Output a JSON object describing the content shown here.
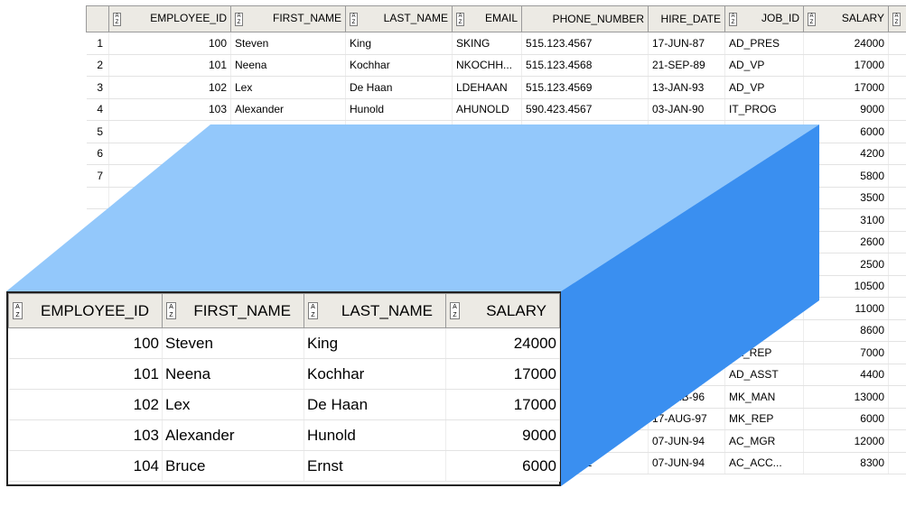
{
  "background_table": {
    "columns": [
      "EMPLOYEE_ID",
      "FIRST_NAME",
      "LAST_NAME",
      "EMAIL",
      "PHONE_NUMBER",
      "HIRE_DATE",
      "JOB_ID",
      "SALARY"
    ],
    "rows": [
      {
        "n": "1",
        "id": "100",
        "first": "Steven",
        "last": "King",
        "email": "SKING",
        "phone": "515.123.4567",
        "hire": "17-JUN-87",
        "job": "AD_PRES",
        "salary": "24000"
      },
      {
        "n": "2",
        "id": "101",
        "first": "Neena",
        "last": "Kochhar",
        "email": "NKOCHH...",
        "phone": "515.123.4568",
        "hire": "21-SEP-89",
        "job": "AD_VP",
        "salary": "17000"
      },
      {
        "n": "3",
        "id": "102",
        "first": "Lex",
        "last": "De Haan",
        "email": "LDEHAAN",
        "phone": "515.123.4569",
        "hire": "13-JAN-93",
        "job": "AD_VP",
        "salary": "17000"
      },
      {
        "n": "4",
        "id": "103",
        "first": "Alexander",
        "last": "Hunold",
        "email": "AHUNOLD",
        "phone": "590.423.4567",
        "hire": "03-JAN-90",
        "job": "IT_PROG",
        "salary": "9000"
      },
      {
        "n": "5",
        "id": "",
        "first": "",
        "last": "",
        "email": "",
        "phone": "",
        "hire": "",
        "job": "",
        "salary": "6000"
      },
      {
        "n": "6",
        "id": "",
        "first": "",
        "last": "",
        "email": "",
        "phone": "",
        "hire": "",
        "job": "",
        "salary": "4200"
      },
      {
        "n": "7",
        "id": "",
        "first": "",
        "last": "",
        "email": "",
        "phone": "",
        "hire": "",
        "job": "",
        "salary": "5800"
      },
      {
        "n": "",
        "id": "",
        "first": "",
        "last": "",
        "email": "",
        "phone": "",
        "hire": "",
        "job": "",
        "salary": "3500"
      },
      {
        "n": "",
        "id": "",
        "first": "",
        "last": "",
        "email": "",
        "phone": "",
        "hire": "",
        "job": "",
        "salary": "3100"
      },
      {
        "n": "",
        "id": "",
        "first": "",
        "last": "",
        "email": "",
        "phone": "",
        "hire": "",
        "job": "",
        "salary": "2600"
      },
      {
        "n": "",
        "id": "",
        "first": "",
        "last": "",
        "email": "",
        "phone": "",
        "hire": "",
        "job": "",
        "salary": "2500"
      },
      {
        "n": "",
        "id": "",
        "first": "",
        "last": "",
        "email": "",
        "phone": "",
        "hire": "",
        "job": "",
        "salary": "10500"
      },
      {
        "n": "",
        "id": "",
        "first": "",
        "last": "",
        "email": "",
        "phone": "",
        "hire": "",
        "job": "EP",
        "salary": "11000"
      },
      {
        "n": "",
        "id": "",
        "first": "",
        "last": "",
        "email": "",
        "phone": "",
        "hire": "",
        "job": "SA_REP",
        "salary": "8600"
      },
      {
        "n": "",
        "id": "",
        "first": "",
        "last": "",
        "email": "",
        "phone": "",
        "hire": "Y-99",
        "job": "SA_REP",
        "salary": "7000"
      },
      {
        "n": "",
        "id": "",
        "first": "",
        "last": "",
        "email": "",
        "phone": "",
        "hire": "17-SEP-87",
        "job": "AD_ASST",
        "salary": "4400"
      },
      {
        "n": "",
        "id": "",
        "first": "",
        "last": "",
        "email": "",
        "phone": "",
        "hire": "17-FEB-96",
        "job": "MK_MAN",
        "salary": "13000"
      },
      {
        "n": "",
        "id": "",
        "first": "",
        "last": "",
        "email": "",
        "phone": "566",
        "hire": "17-AUG-97",
        "job": "MK_REP",
        "salary": "6000"
      },
      {
        "n": "19",
        "id": "205",
        "first": "Shelley",
        "last": "Higgins",
        "email": "SHIGGINS",
        "phone": "515.123.8080",
        "hire": "07-JUN-94",
        "job": "AC_MGR",
        "salary": "12000"
      },
      {
        "n": "20",
        "id": "206",
        "first": "William",
        "last": "Gietz",
        "email": "WGIETZ",
        "phone": "515.123.8181",
        "hire": "07-JUN-94",
        "job": "AC_ACC...",
        "salary": "8300"
      }
    ]
  },
  "foreground_table": {
    "columns": [
      "EMPLOYEE_ID",
      "FIRST_NAME",
      "LAST_NAME",
      "SALARY"
    ],
    "rows": [
      {
        "id": "100",
        "first": "Steven",
        "last": "King",
        "salary": "24000"
      },
      {
        "id": "101",
        "first": "Neena",
        "last": "Kochhar",
        "salary": "17000"
      },
      {
        "id": "102",
        "first": "Lex",
        "last": "De Haan",
        "salary": "17000"
      },
      {
        "id": "103",
        "first": "Alexander",
        "last": "Hunold",
        "salary": "9000"
      },
      {
        "id": "104",
        "first": "Bruce",
        "last": "Ernst",
        "salary": "6000"
      }
    ]
  },
  "colors": {
    "slab_top": "#93c8fb",
    "slab_side": "#3a8ff0",
    "header_bg": "#eceae4"
  }
}
